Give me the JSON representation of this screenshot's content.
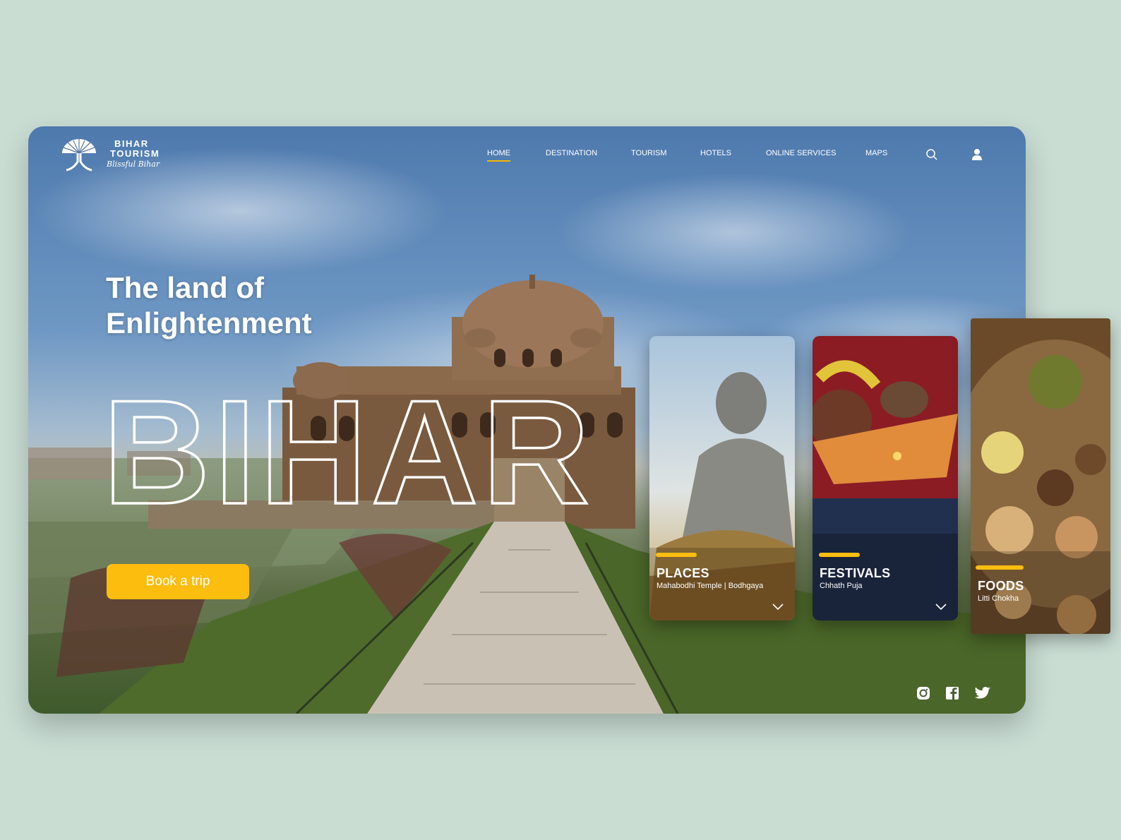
{
  "brand": {
    "line1": "BIHAR",
    "line2": "TOURISM",
    "tagline": "Blissful Bihar"
  },
  "nav": {
    "items": [
      {
        "label": "HOME",
        "active": true
      },
      {
        "label": "DESTINATION",
        "active": false
      },
      {
        "label": "TOURISM",
        "active": false
      },
      {
        "label": "HOTELS",
        "active": false
      },
      {
        "label": "ONLINE SERVICES",
        "active": false
      },
      {
        "label": "MAPS",
        "active": false
      }
    ],
    "icons": [
      "search-icon",
      "user-icon"
    ]
  },
  "hero": {
    "headline_line1": "The land of",
    "headline_line2": "Enlightenment",
    "big_word": "BIHAR",
    "cta_label": "Book a trip"
  },
  "cards": [
    {
      "title": "PLACES",
      "subtitle": "Mahabodhi Temple | Bodhgaya"
    },
    {
      "title": "FESTIVALS",
      "subtitle": "Chhath Puja"
    },
    {
      "title": "FOODS",
      "subtitle": "Litti Chokha"
    }
  ],
  "social": [
    "instagram-icon",
    "facebook-icon",
    "twitter-icon"
  ],
  "colors": {
    "accent": "#fdbd0e",
    "page_background": "#c9ddd3"
  }
}
